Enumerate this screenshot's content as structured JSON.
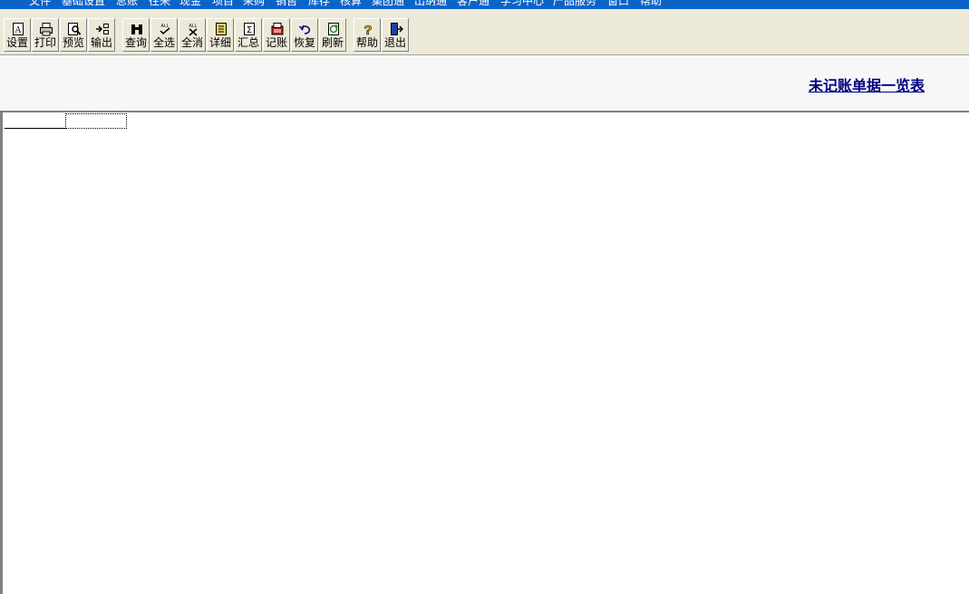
{
  "menu": {
    "items": [
      "文件",
      "基础设置",
      "总账",
      "往来",
      "现金",
      "项目",
      "采购",
      "销售",
      "库存",
      "核算",
      "集团通",
      "出纳通",
      "客户通",
      "学习中心",
      "产品服务",
      "窗口",
      "帮助"
    ]
  },
  "toolbar": {
    "buttons": [
      {
        "label": "设置",
        "icon": "page-setup-icon"
      },
      {
        "label": "打印",
        "icon": "printer-icon"
      },
      {
        "label": "预览",
        "icon": "preview-icon"
      },
      {
        "label": "输出",
        "icon": "export-icon"
      },
      {
        "label": "查询",
        "icon": "binoculars-icon"
      },
      {
        "label": "全选",
        "icon": "select-all-icon"
      },
      {
        "label": "全消",
        "icon": "deselect-all-icon"
      },
      {
        "label": "详细",
        "icon": "detail-icon"
      },
      {
        "label": "汇总",
        "icon": "sum-icon"
      },
      {
        "label": "记账",
        "icon": "post-icon"
      },
      {
        "label": "恢复",
        "icon": "undo-icon"
      },
      {
        "label": "刷新",
        "icon": "refresh-icon"
      },
      {
        "label": "帮助",
        "icon": "help-icon"
      },
      {
        "label": "退出",
        "icon": "exit-icon"
      }
    ]
  },
  "report": {
    "title": "未记账单据一览表"
  },
  "colors": {
    "menubar": "#0a64c8",
    "toolbar": "#ece9d8",
    "title": "#000080"
  }
}
